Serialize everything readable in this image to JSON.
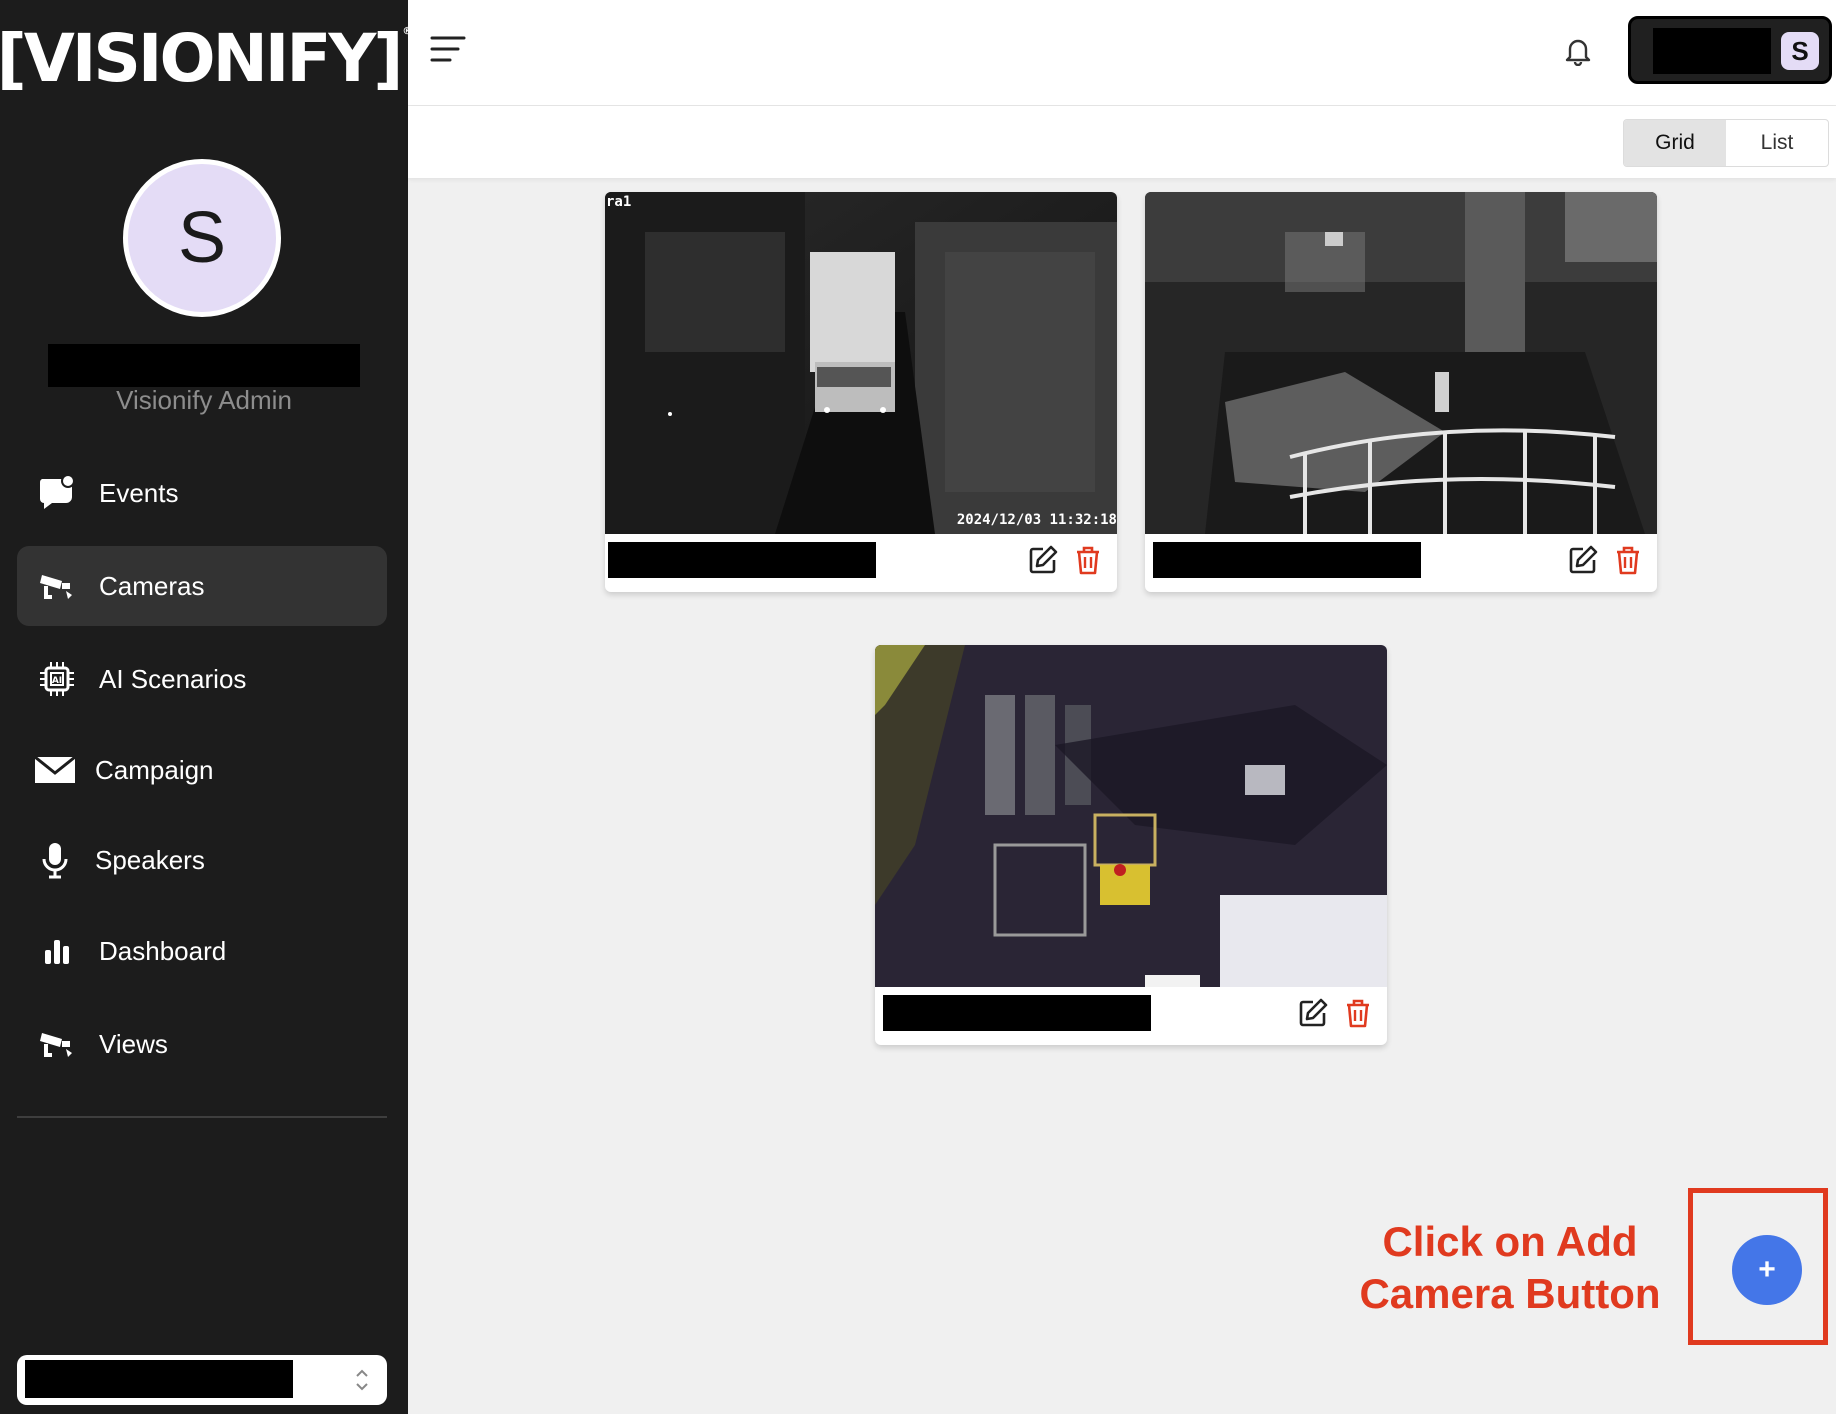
{
  "brand": {
    "logo_text": "[VISIONIFY]"
  },
  "profile": {
    "initial": "S",
    "role": "Visionify Admin"
  },
  "nav": [
    {
      "label": "Events",
      "icon": "chat-bubble-icon"
    },
    {
      "label": "Cameras",
      "icon": "cctv-camera-icon",
      "active": true
    },
    {
      "label": "AI Scenarios",
      "icon": "ai-chip-icon"
    },
    {
      "label": "Campaign",
      "icon": "envelope-icon"
    },
    {
      "label": "Speakers",
      "icon": "microphone-icon"
    },
    {
      "label": "Dashboard",
      "icon": "bar-chart-icon"
    },
    {
      "label": "Views",
      "icon": "cctv-camera-icon"
    }
  ],
  "topbar": {
    "user_initial": "S"
  },
  "view_toggle": {
    "grid_label": "Grid",
    "list_label": "List",
    "selected": "Grid"
  },
  "cameras": [
    {
      "overlay_label": "ra1",
      "timestamp": "2024/12/03 11:32:18"
    },
    {
      "overlay_label": "",
      "timestamp": ""
    },
    {
      "overlay_label": "",
      "timestamp": ""
    }
  ],
  "fab": {
    "label": "+"
  },
  "annotation": {
    "line1": "Click on Add",
    "line2": "Camera Button"
  },
  "colors": {
    "accent": "#4476e8",
    "annotation": "#e03a1f",
    "sidebar": "#1c1c1c",
    "delete": "#e03a1f"
  }
}
